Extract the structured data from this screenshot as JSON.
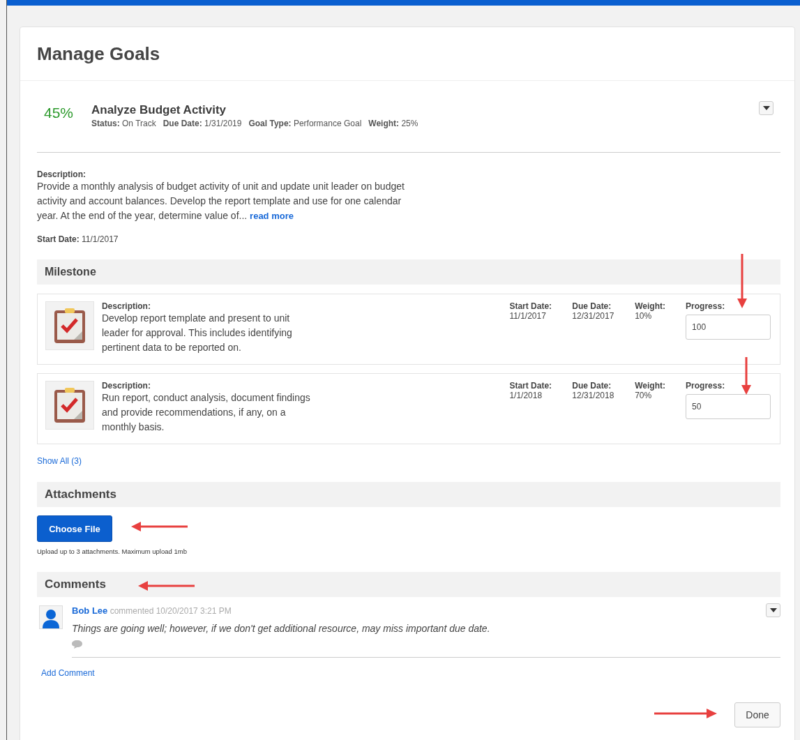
{
  "title": "Manage Goals",
  "goal": {
    "percent": "45%",
    "name": "Analyze Budget Activity",
    "meta": [
      {
        "label": "Status:",
        "value": "On Track"
      },
      {
        "label": "Due Date:",
        "value": "1/31/2019"
      },
      {
        "label": "Goal Type:",
        "value": "Performance Goal"
      },
      {
        "label": "Weight:",
        "value": "25%"
      }
    ],
    "description_label": "Description:",
    "description": "Provide a monthly analysis of budget activity of unit and update unit leader on budget activity and account balances. Develop the report template and use for one calendar year. At the end of the year, determine value of...",
    "read_more": "read more",
    "start_label": "Start Date:",
    "start_date": "11/1/2017"
  },
  "milestone": {
    "heading": "Milestone",
    "items": [
      {
        "description_label": "Description:",
        "description": "Develop report template and present to unit leader for approval. This includes identifying pertinent data to be reported on.",
        "start_label": "Start Date:",
        "start": "11/1/2017",
        "due_label": "Due Date:",
        "due": "12/31/2017",
        "weight_label": "Weight:",
        "weight": "10%",
        "progress_label": "Progress:",
        "progress": "100"
      },
      {
        "description_label": "Description:",
        "description": "Run report, conduct analysis, document findings and provide recommendations, if any, on a monthly basis.",
        "start_label": "Start Date:",
        "start": "1/1/2018",
        "due_label": "Due Date:",
        "due": "12/31/2018",
        "weight_label": "Weight:",
        "weight": "70%",
        "progress_label": "Progress:",
        "progress": "50"
      }
    ],
    "show_all": "Show All (3)"
  },
  "attachments": {
    "heading": "Attachments",
    "button": "Choose File",
    "hint": "Upload up to 3 attachments. Maximum upload 1mb"
  },
  "comments": {
    "heading": "Comments",
    "items": [
      {
        "author": "Bob Lee",
        "meta": "commented 10/20/2017 3:21 PM",
        "text": "Things are going well; however, if we don't get additional resource, may miss important due date."
      }
    ],
    "add": "Add Comment"
  },
  "done": "Done"
}
